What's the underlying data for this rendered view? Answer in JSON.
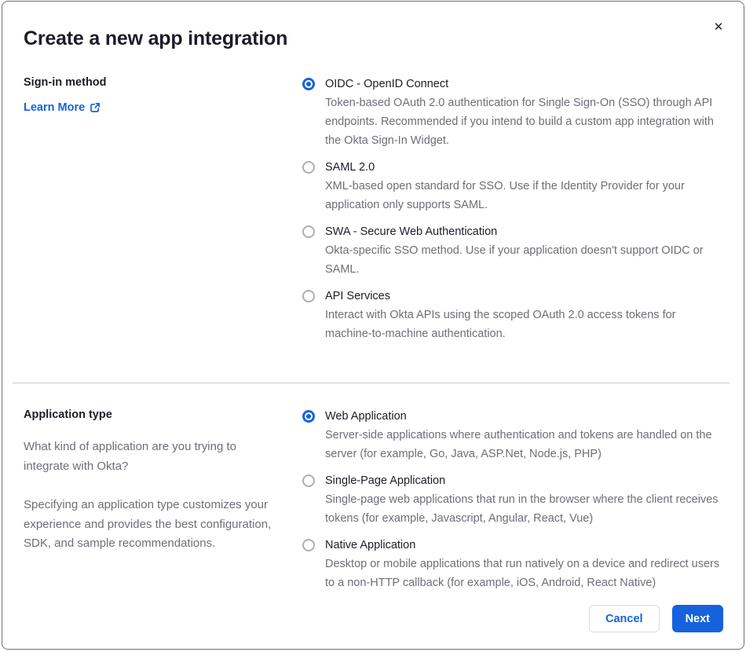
{
  "dialog": {
    "title": "Create a new app integration",
    "close_icon": "✕"
  },
  "colors": {
    "accent_blue": "#1662dd",
    "text_primary": "#1d1d29",
    "text_secondary": "#6e6e78",
    "divider": "#c9c9cf"
  },
  "sections": [
    {
      "label": "Sign-in method",
      "link": {
        "label": "Learn More"
      },
      "options": [
        {
          "label": "OIDC - OpenID Connect",
          "description": "Token-based OAuth 2.0 authentication for Single Sign-On (SSO) through API endpoints. Recommended if you intend to build a custom app integration with the Okta Sign-In Widget.",
          "selected": true
        },
        {
          "label": "SAML 2.0",
          "description": "XML-based open standard for SSO. Use if the Identity Provider for your application only supports SAML.",
          "selected": false
        },
        {
          "label": "SWA - Secure Web Authentication",
          "description": "Okta-specific SSO method. Use if your application doesn't support OIDC or SAML.",
          "selected": false
        },
        {
          "label": "API Services",
          "description": "Interact with Okta APIs using the scoped OAuth 2.0 access tokens for machine-to-machine authentication.",
          "selected": false
        }
      ]
    },
    {
      "label": "Application type",
      "paragraphs": [
        "What kind of application are you trying to integrate with Okta?",
        "Specifying an application type customizes your experience and provides the best configuration, SDK, and sample recommendations."
      ],
      "options": [
        {
          "label": "Web Application",
          "description": "Server-side applications where authentication and tokens are handled on the server (for example, Go, Java, ASP.Net, Node.js, PHP)",
          "selected": true
        },
        {
          "label": "Single-Page Application",
          "description": "Single-page web applications that run in the browser where the client receives tokens (for example, Javascript, Angular, React, Vue)",
          "selected": false
        },
        {
          "label": "Native Application",
          "description": "Desktop or mobile applications that run natively on a device and redirect users to a non-HTTP callback (for example, iOS, Android, React Native)",
          "selected": false
        }
      ]
    }
  ],
  "footer": {
    "cancel_label": "Cancel",
    "next_label": "Next"
  }
}
